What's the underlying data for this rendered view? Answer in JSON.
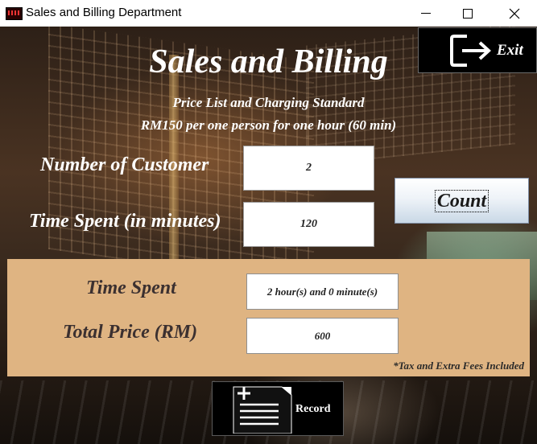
{
  "window": {
    "title": "Sales and Billing Department",
    "minimize_icon": "minimize-icon",
    "maximize_icon": "maximize-icon",
    "close_icon": "close-icon"
  },
  "header": {
    "title": "Sales and Billing",
    "price_list": "Price List and Charging Standard",
    "rate": "RM150 per one person for one hour (60 min)"
  },
  "exit": {
    "label": "Exit",
    "icon": "exit-icon"
  },
  "form": {
    "customers_label": "Number of Customer",
    "customers_value": "2",
    "minutes_label": "Time Spent (in minutes)",
    "minutes_value": "120",
    "count_label": "Count"
  },
  "results": {
    "time_label": "Time Spent",
    "time_value": "2 hour(s) and 0 minute(s)",
    "price_label": "Total Price (RM)",
    "price_value": "600",
    "note": "*Tax and Extra Fees Included",
    "panel_color": "#dfb482"
  },
  "record": {
    "label": "Record",
    "icon": "record-list-icon"
  }
}
